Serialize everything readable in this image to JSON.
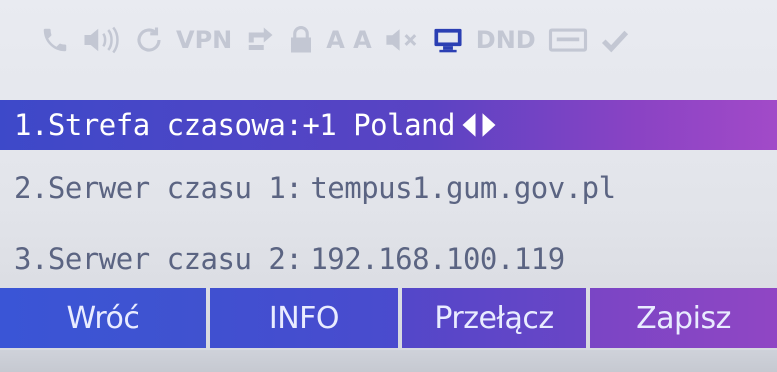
{
  "statusbar": {
    "icons": [
      {
        "name": "phone-icon",
        "active": false
      },
      {
        "name": "speaker-icon",
        "active": false
      },
      {
        "name": "sync-icon",
        "active": false
      },
      {
        "name": "vpn-label",
        "text": "VPN",
        "active": false
      },
      {
        "name": "forward-icon",
        "active": false
      },
      {
        "name": "lock-icon",
        "active": false
      },
      {
        "name": "aa-label",
        "text": "A A",
        "active": false
      },
      {
        "name": "mute-icon",
        "active": false
      },
      {
        "name": "network-icon",
        "active": true
      },
      {
        "name": "dnd-label",
        "text": "DND",
        "active": false
      },
      {
        "name": "message-icon",
        "active": false
      },
      {
        "name": "checkmark-icon",
        "active": false
      }
    ],
    "vpn_text": "VPN",
    "aa_text": "A A",
    "dnd_text": "DND"
  },
  "menu": {
    "items": [
      {
        "label": "1.Strefa czasowa:",
        "value": "+1 Poland",
        "selected": true
      },
      {
        "label": "2.Serwer czasu 1:",
        "value": "tempus1.gum.gov.pl",
        "selected": false
      },
      {
        "label": "3.Serwer czasu 2:",
        "value": "192.168.100.119",
        "selected": false
      }
    ]
  },
  "softkeys": {
    "back": "Wróć",
    "info": "INFO",
    "switch": "Przełącz",
    "save": "Zapisz"
  },
  "colors": {
    "selected_row_start": "#3d49c9",
    "selected_row_end": "#a24ac8",
    "text_gray": "#5b6482",
    "status_active": "#2b3fb3",
    "status_inactive": "#c3c7d3"
  }
}
